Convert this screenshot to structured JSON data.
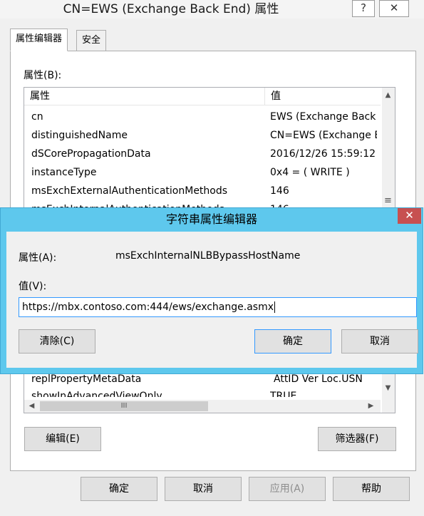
{
  "window": {
    "title": "CN=EWS (Exchange Back End) 属性",
    "help_glyph": "?",
    "close_glyph": "✕"
  },
  "tabs": [
    {
      "label": "属性编辑器",
      "active": true
    },
    {
      "label": "安全",
      "active": false
    }
  ],
  "attributes_label": "属性(B):",
  "list": {
    "headers": [
      "属性",
      "值"
    ],
    "rows": [
      {
        "name": "cn",
        "value": "EWS (Exchange Back"
      },
      {
        "name": "distinguishedName",
        "value": "CN=EWS (Exchange B"
      },
      {
        "name": "dSCorePropagationData",
        "value": "2016/12/26 15:59:12"
      },
      {
        "name": "instanceType",
        "value": "0x4 = ( WRITE )"
      },
      {
        "name": "msExchExternalAuthenticationMethods",
        "value": "146"
      },
      {
        "name": "msExchInternalAuthenticationMethods",
        "value": "146"
      },
      {
        "name": "replPropertyMetaData",
        "value": "AttID  Ver    Loc.USN"
      },
      {
        "name": "showInAdvancedViewOnly",
        "value": "TRUE"
      }
    ],
    "hscroll_thumb_glyph": "III",
    "vscroll_thumb_glyph": "≡"
  },
  "buttons": {
    "edit": "编辑(E)",
    "filter": "筛选器(F)",
    "ok": "确定",
    "cancel": "取消",
    "apply": "应用(A)",
    "help": "帮助"
  },
  "dialog": {
    "title": "字符串属性编辑器",
    "close_glyph": "✕",
    "attribute_label": "属性(A):",
    "attribute_value": "msExchInternalNLBBypassHostName",
    "value_label": "值(V):",
    "value": "https://mbx.contoso.com:444/ews/exchange.asmx",
    "clear_button": "清除(C)",
    "ok_button": "确定",
    "cancel_button": "取消"
  },
  "colors": {
    "dialog_frame": "#5ec8ed",
    "close_button": "#c75050",
    "input_focus_border": "#3399ff"
  }
}
